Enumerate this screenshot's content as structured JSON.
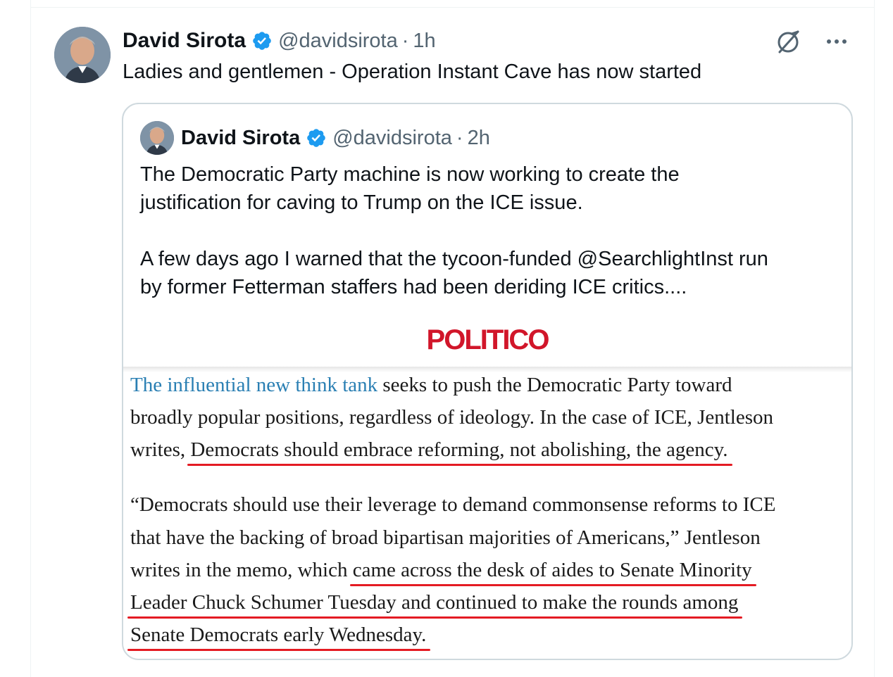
{
  "tweet": {
    "author_name": "David Sirota",
    "handle": "@davidsirota",
    "separator": "·",
    "time": "1h",
    "text": "Ladies and gentlemen - Operation Instant Cave has now started"
  },
  "quoted_tweet": {
    "author_name": "David Sirota",
    "handle": "@davidsirota",
    "separator": "·",
    "time": "2h",
    "text_lines": [
      "The Democratic Party machine is now working to create the",
      "justification for caving to Trump on the ICE issue.",
      "A few days ago I warned that the tycoon-funded @SearchlightInst run",
      "by former Fetterman staffers had been deriding ICE critics...."
    ]
  },
  "media": {
    "logo_text": "POLITICO",
    "article": {
      "p1_l1_link": "The influential new think tank",
      "p1_l1_rest": " seeks to push the Democratic Party toward",
      "p1_l2": "broadly popular positions, regardless of ideology. In the case of ICE, Jentleson",
      "p1_l3_pre": "writes, ",
      "p1_l3_underlined": "Democrats should embrace reforming, not abolishing, the agency.",
      "p2_l1": "“Democrats should use their leverage to demand commonsense reforms to ICE",
      "p2_l2": "that have the backing of broad bipartisan majorities of Americans,” Jentleson",
      "p2_l3_pre": "writes in the memo, which ",
      "p2_l3_underlined": "came across the desk of aides to Senate Minority",
      "p2_l4_underlined": "Leader Chuck Schumer Tuesday and continued to make the rounds among",
      "p2_l5_underlined": "Senate Democrats early Wednesday."
    }
  },
  "colors": {
    "verified": "#1d9bf0",
    "politico_red": "#d1162a",
    "underline_red": "#e41b23",
    "link_blue": "#2a7fb3"
  },
  "icons": [
    "verified-badge-icon",
    "grok-icon",
    "more-icon"
  ]
}
